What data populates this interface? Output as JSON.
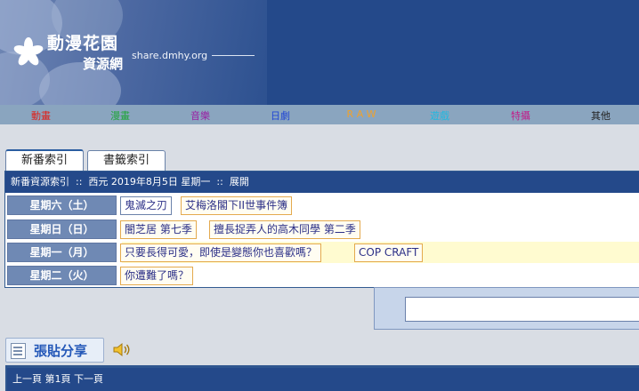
{
  "header": {
    "site_name": "動漫花園",
    "site_subtitle": "資源網",
    "site_url": "share.dmhy.org"
  },
  "nav": {
    "items": [
      {
        "label": "動畫",
        "color": "#e0211a"
      },
      {
        "label": "漫畫",
        "color": "#20a53a"
      },
      {
        "label": "音樂",
        "color": "#9a1fa3"
      },
      {
        "label": "日劇",
        "color": "#2046d4"
      },
      {
        "label": "RAW",
        "color": "#f0a22c"
      },
      {
        "label": "遊戲",
        "color": "#1fb8e0"
      },
      {
        "label": "特攝",
        "color": "#c21d8a"
      },
      {
        "label": "其他",
        "color": "#222222"
      }
    ]
  },
  "tabs": {
    "new_index": "新番索引",
    "bookmark_index": "書籤索引"
  },
  "index": {
    "title": "新番資源索引",
    "separator": "::",
    "date": "西元 2019年8月5日 星期一",
    "expand": "展開",
    "rows": [
      {
        "day": "星期六（土）",
        "items": [
          "鬼滅之刃",
          "艾梅洛閣下II世事件簿"
        ]
      },
      {
        "day": "星期日（日）",
        "items": [
          "闇芝居 第七季",
          "擅長捉弄人的高木同學 第二季"
        ]
      },
      {
        "day": "星期一（月）",
        "items": [
          "只要長得可愛，即使是變態你也喜歡嗎？",
          "COP CRAFT"
        ]
      },
      {
        "day": "星期二（火）",
        "items": [
          "你遭難了嗎？"
        ]
      }
    ]
  },
  "post_button": {
    "label": "張貼分享"
  },
  "pager": {
    "text": "上一頁 第1頁 下一頁"
  }
}
